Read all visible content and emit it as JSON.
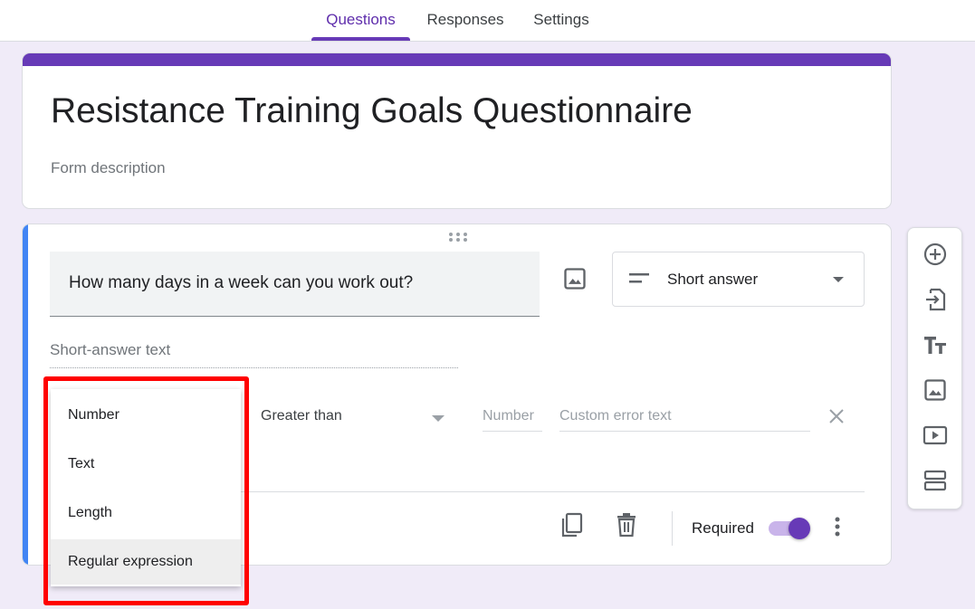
{
  "tabs": [
    {
      "label": "Questions",
      "active": true
    },
    {
      "label": "Responses",
      "active": false
    },
    {
      "label": "Settings",
      "active": false
    }
  ],
  "form": {
    "title": "Resistance Training Goals Questionnaire",
    "description_placeholder": "Form description"
  },
  "question": {
    "text": "How many days in a week can you work out?",
    "type": "Short answer",
    "answer_placeholder": "Short-answer text",
    "validation": {
      "condition": "Greater than",
      "number_placeholder": "Number",
      "error_placeholder": "Custom error text"
    },
    "required_label": "Required",
    "required": true
  },
  "validation_menu": {
    "items": [
      {
        "label": "Number",
        "selected": false
      },
      {
        "label": "Text",
        "selected": false
      },
      {
        "label": "Length",
        "selected": false
      },
      {
        "label": "Regular expression",
        "selected": true
      }
    ]
  },
  "side_toolbar": {
    "tools": [
      "add-question-icon",
      "import-questions-icon",
      "add-title-icon",
      "add-image-icon",
      "add-video-icon",
      "add-section-icon"
    ]
  },
  "colors": {
    "accent": "#673ab7",
    "background": "#f0ebf8",
    "question_accent": "#4285f4",
    "highlight": "#ff0000"
  }
}
